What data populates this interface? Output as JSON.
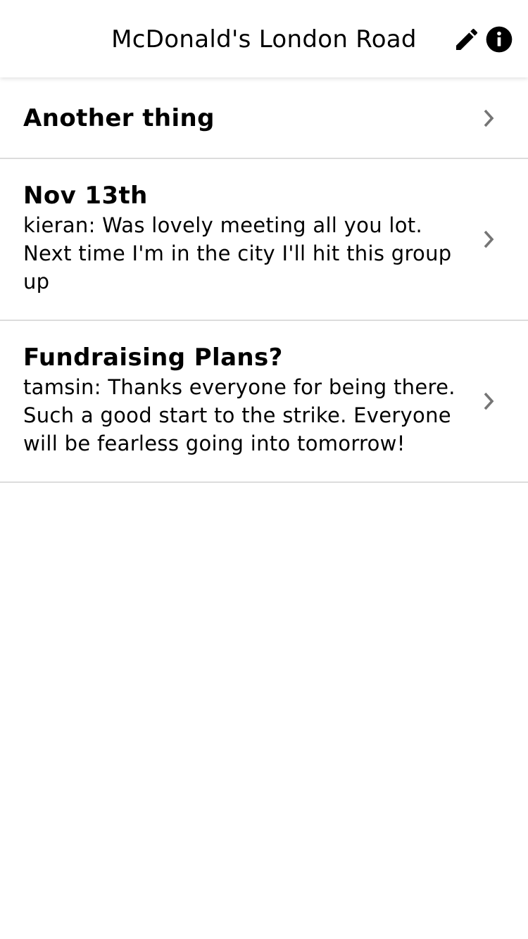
{
  "header": {
    "title": "McDonald's London Road",
    "edit_icon": "pencil-icon",
    "info_icon": "info-icon"
  },
  "threads": [
    {
      "title": "Another thing",
      "preview": ""
    },
    {
      "title": "Nov 13th",
      "preview": "kieran: Was lovely meeting all you lot. Next time I'm in the city I'll hit this group up"
    },
    {
      "title": "Fundraising Plans?",
      "preview": "tamsin: Thanks everyone for being there. Such a good start to the strike. Everyone will be fearless going into tomorrow!"
    }
  ],
  "colors": {
    "background": "#ffffff",
    "text": "#000000",
    "divider": "#dcdcdc",
    "chevron": "#757575"
  }
}
